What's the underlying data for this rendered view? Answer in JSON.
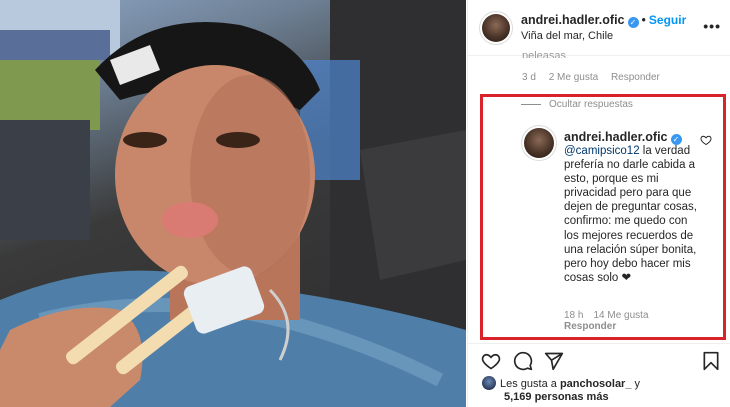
{
  "post": {
    "author": "andrei.hadler.ofic",
    "follow_label": "Seguir",
    "location": "Viña del mar, Chile",
    "separator": "•",
    "more_label": "•••"
  },
  "prev_comment": {
    "truncated_text": "peleasas.",
    "age": "3 d",
    "likes": "2 Me gusta",
    "reply_label": "Responder"
  },
  "replies": {
    "toggle_label": "Ocultar respuestas",
    "items": [
      {
        "author": "andrei.hadler.ofic",
        "mention": "@camipsico12",
        "text": " la verdad prefería no darle cabida a esto, porque es mi privacidad pero para que dejen de preguntar cosas, confirmo: me quedo con los mejores recuerdos de una relación súper bonita, pero hoy debo hacer mis cosas solo ❤",
        "age": "18 h",
        "likes": "14 Me gusta",
        "reply_label": "Responder"
      }
    ]
  },
  "likes_line": {
    "prefix": "Les gusta a ",
    "user": "panchosolar_",
    "suffix": " y",
    "others": "5,169 personas más"
  },
  "icons": [
    "verified-badge-icon",
    "more-options-icon",
    "heart-icon",
    "comment-icon",
    "share-icon",
    "bookmark-icon"
  ],
  "colors": {
    "accent": "#0095f6",
    "verified": "#3897f0",
    "highlight_border": "#d9222a",
    "muted": "#8e8e8e"
  }
}
